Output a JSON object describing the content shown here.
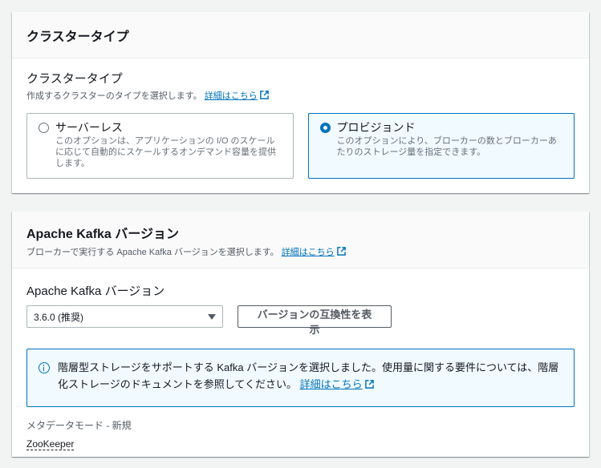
{
  "cluster_type_section": {
    "header": "クラスタータイプ",
    "field_label": "クラスタータイプ",
    "description": "作成するクラスターのタイプを選択します。",
    "info_link": "詳細はこちら",
    "options": [
      {
        "title": "サーバーレス",
        "description": "このオプションは、アプリケーションの I/O のスケールに応じて自動的にスケールするオンデマンド容量を提供します。",
        "selected": false
      },
      {
        "title": "プロビジョンド",
        "description": "このオプションにより、ブローカーの数とブローカーあたりのストレージ量を指定できます。",
        "selected": true
      }
    ]
  },
  "kafka_section": {
    "header": "Apache Kafka バージョン",
    "description": "ブローカーで実行する Apache Kafka バージョンを選択します。",
    "info_link": "詳細はこちら",
    "field_label": "Apache Kafka バージョン",
    "select_value": "3.6.0 (推奨)",
    "compat_button": "バージョンの互換性を表示",
    "info_alert": {
      "text": "階層型ストレージをサポートする Kafka バージョンを選択しました。使用量に関する要件については、階層化ストレージのドキュメントを参照してください。",
      "link": "詳細はこちら"
    },
    "metadata_label": "メタデータモード - 新規",
    "metadata_value": "ZooKeeper"
  },
  "colors": {
    "accent": "#0073bb",
    "selected_bg": "#f1faff",
    "page_bg": "#f2f3f3"
  }
}
